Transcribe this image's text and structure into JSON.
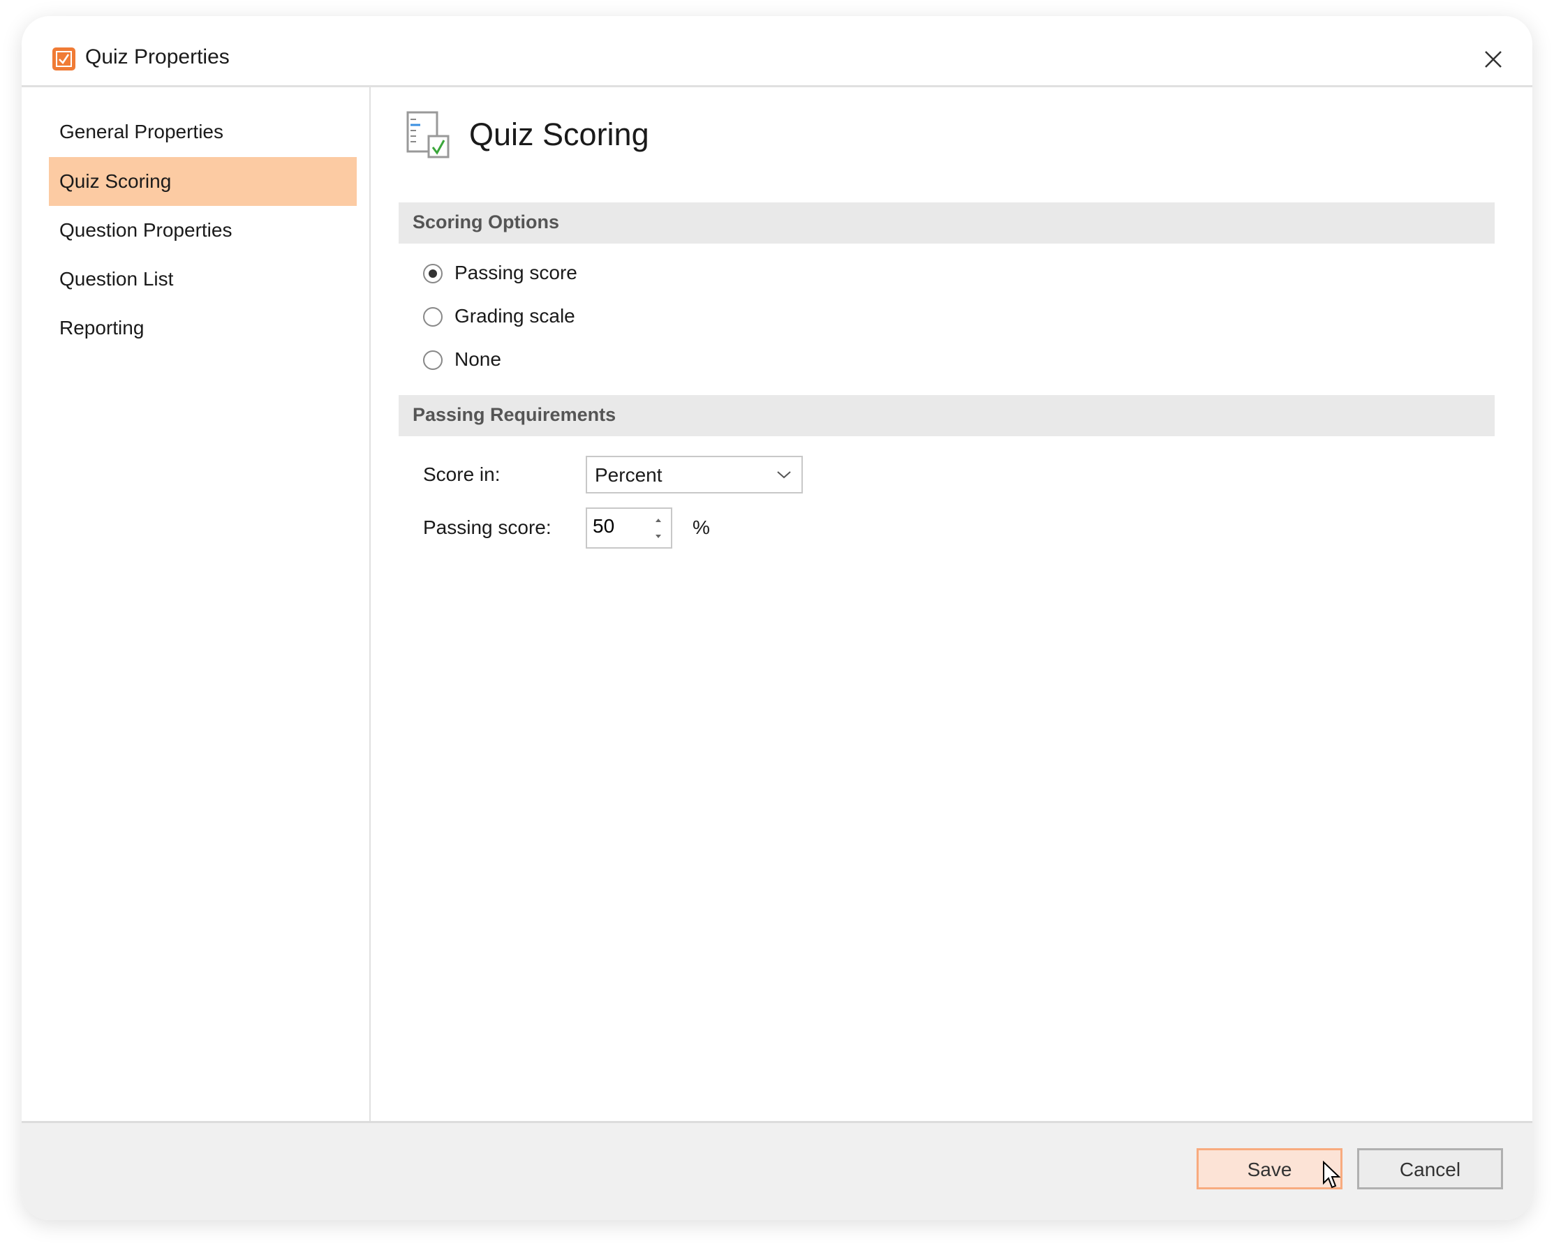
{
  "window": {
    "title": "Quiz Properties",
    "accent": "#f07b35",
    "icon": "checkbox-icon"
  },
  "sidebar": {
    "items": [
      {
        "label": "General Properties",
        "active": false
      },
      {
        "label": "Quiz Scoring",
        "active": true
      },
      {
        "label": "Question Properties",
        "active": false
      },
      {
        "label": "Question List",
        "active": false
      },
      {
        "label": "Reporting",
        "active": false
      }
    ],
    "active_color": "#fccba3"
  },
  "main": {
    "heading": "Quiz Scoring",
    "heading_icon": "quiz-scoring-icon",
    "scoring_options": {
      "title": "Scoring Options",
      "options": [
        {
          "label": "Passing score",
          "selected": true
        },
        {
          "label": "Grading scale",
          "selected": false
        },
        {
          "label": "None",
          "selected": false
        }
      ]
    },
    "passing_requirements": {
      "title": "Passing Requirements",
      "score_in_label": "Score in:",
      "score_in_value": "Percent",
      "passing_score_label": "Passing score:",
      "passing_score_value": "50",
      "unit": "%"
    }
  },
  "footer": {
    "save_label": "Save",
    "cancel_label": "Cancel"
  }
}
